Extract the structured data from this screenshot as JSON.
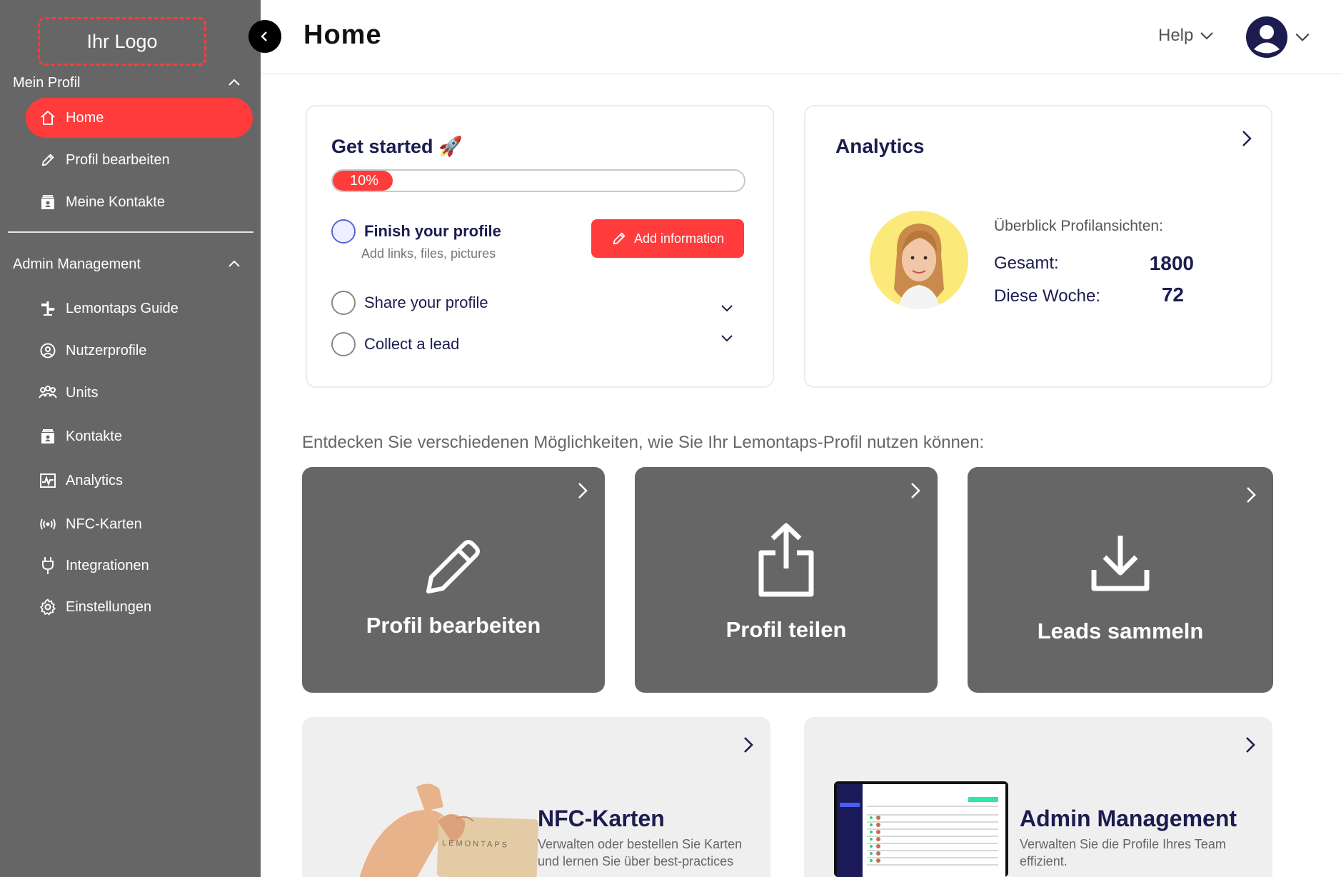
{
  "sidebar": {
    "logo": "Ihr Logo",
    "profile_section": "Mein Profil",
    "profile_items": [
      {
        "label": "Home",
        "icon": "home-icon",
        "active": true
      },
      {
        "label": "Profil bearbeiten",
        "icon": "pencil-icon"
      },
      {
        "label": "Meine Kontakte",
        "icon": "contacts-icon"
      }
    ],
    "admin_section": "Admin Management",
    "admin_items": [
      {
        "label": "Lemontaps Guide",
        "icon": "signpost-icon"
      },
      {
        "label": "Nutzerprofile",
        "icon": "user-circle-icon"
      },
      {
        "label": "Units",
        "icon": "group-icon"
      },
      {
        "label": "Kontakte",
        "icon": "contacts-icon"
      },
      {
        "label": "Analytics",
        "icon": "chart-icon"
      },
      {
        "label": "NFC-Karten",
        "icon": "nfc-icon"
      },
      {
        "label": "Integrationen",
        "icon": "plug-icon"
      },
      {
        "label": "Einstellungen",
        "icon": "gear-icon"
      }
    ]
  },
  "header": {
    "title": "Home",
    "help": "Help"
  },
  "get_started": {
    "title": "Get started 🚀",
    "progress_label": "10%",
    "progress_value": 0.1,
    "tasks": [
      {
        "label": "Finish your profile",
        "sub": "Add links, files, pictures"
      },
      {
        "label": "Share your profile"
      },
      {
        "label": "Collect a lead"
      }
    ],
    "add_button": "Add information"
  },
  "analytics": {
    "title": "Analytics",
    "overview": "Überblick Profilansichten:",
    "total_label": "Gesamt:",
    "total_value": "1800",
    "week_label": "Diese Woche:",
    "week_value": "72"
  },
  "discover_text": "Entdecken Sie verschiedenen Möglichkeiten, wie Sie Ihr Lemontaps-Profil nutzen können:",
  "tiles": [
    {
      "label": "Profil bearbeiten",
      "icon": "pencil-icon"
    },
    {
      "label": "Profil teilen",
      "icon": "share-icon"
    },
    {
      "label": "Leads sammeln",
      "icon": "download-icon"
    }
  ],
  "bottom_cards": [
    {
      "title": "NFC-Karten",
      "desc": "Verwalten oder bestellen Sie Karten und lernen Sie über best-practices",
      "card_text": "LEMONTAPS"
    },
    {
      "title": "Admin Management",
      "desc": "Verwalten Sie die Profile Ihres Team effizient."
    }
  ],
  "colors": {
    "accent": "#ff3b3b",
    "sidebar": "#666666",
    "navy": "#1c1c50"
  }
}
